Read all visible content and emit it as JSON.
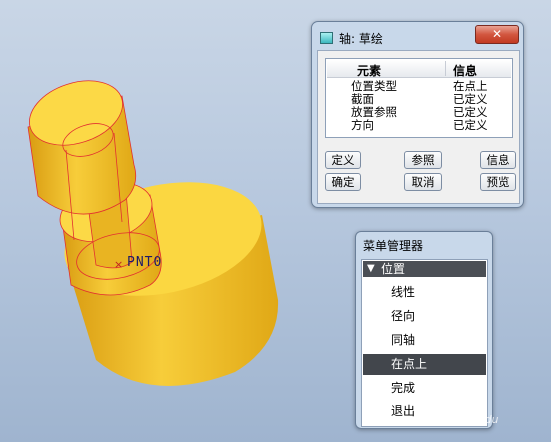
{
  "viewport": {
    "point_label": "PNT0",
    "point_marker": "×",
    "model_color": "#f2c531"
  },
  "dialog": {
    "title": "轴: 草绘",
    "close_label": "✕",
    "columns": [
      "元素",
      "信息"
    ],
    "rows": [
      {
        "element": "位置类型",
        "info": "在点上"
      },
      {
        "element": "截面",
        "info": "已定义"
      },
      {
        "element": "放置参照",
        "info": "已定义"
      },
      {
        "element": "方向",
        "info": "已定义"
      }
    ],
    "buttons": {
      "define": "定义",
      "refs": "参照",
      "info": "信息",
      "ok": "确定",
      "cancel": "取消",
      "preview": "预览"
    }
  },
  "menu": {
    "title": "菜单管理器",
    "header": "位置",
    "items": [
      "线性",
      "径向",
      "同轴",
      "在点上",
      "完成",
      "退出"
    ],
    "selected": "在点上"
  },
  "watermark": "jingyan.baidu"
}
